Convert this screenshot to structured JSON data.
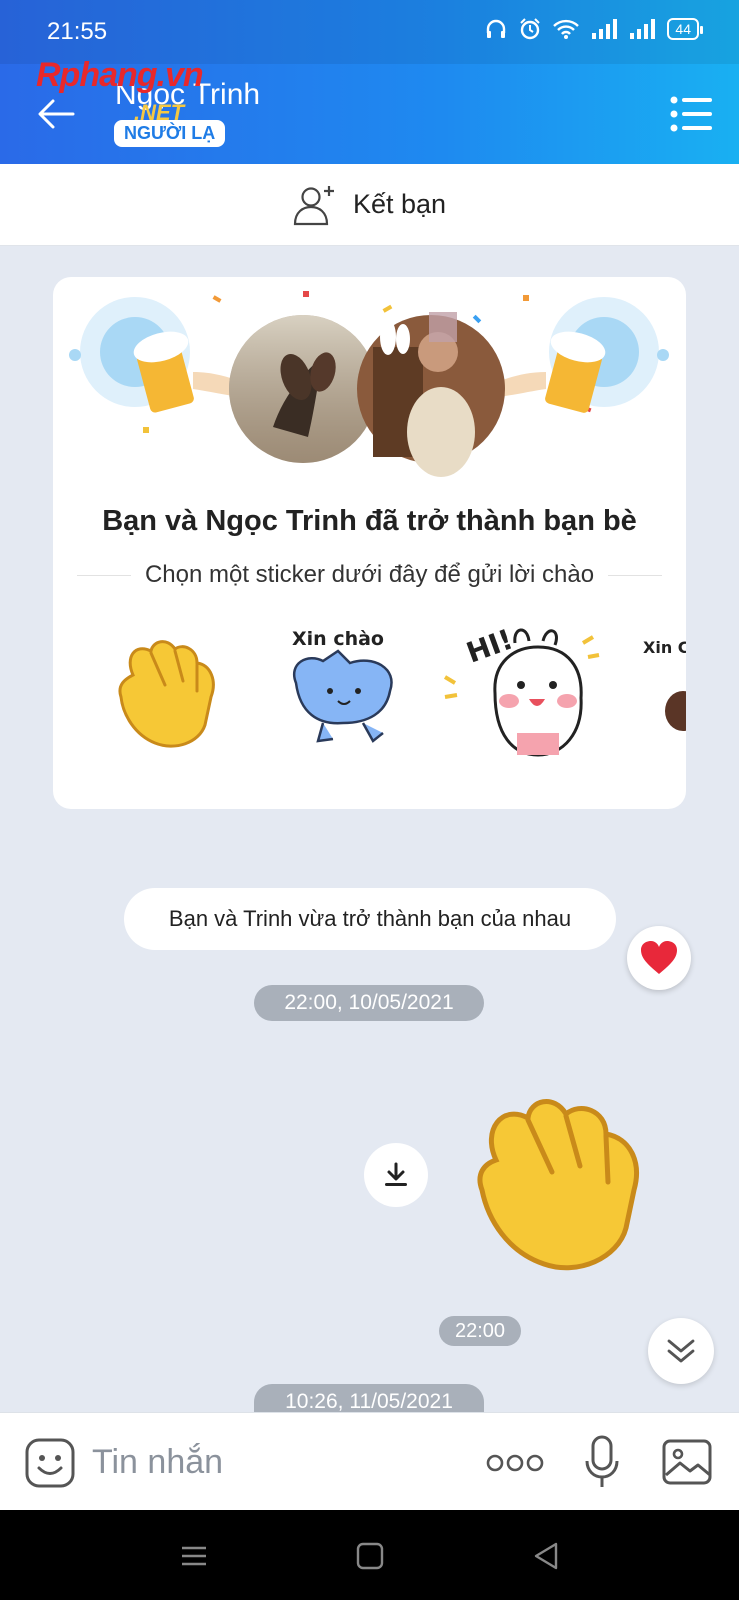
{
  "status_bar": {
    "time": "21:55",
    "battery": "44",
    "icons": [
      "headphones-icon",
      "alarm-icon",
      "wifi-icon",
      "signal-icon",
      "signal-icon",
      "battery-icon"
    ]
  },
  "watermark": {
    "brand": "Rphang.vn",
    "suffix": ".NET"
  },
  "header": {
    "title": "Ngọc Trinh",
    "badge": "NGƯỜI LẠ"
  },
  "add_friend": {
    "label": "Kết bạn"
  },
  "friend_card": {
    "title": "Bạn và Ngọc Trinh đã trở thành bạn bè",
    "subtitle": "Chọn một sticker dưới đây để gửi lời chào",
    "stickers": [
      {
        "name": "wave-hand"
      },
      {
        "name": "xin-chao-cat",
        "text": "Xin chào"
      },
      {
        "name": "hi-bunny",
        "text": "HI!"
      },
      {
        "name": "xin-chao-partial",
        "text": "Xin Chà"
      }
    ]
  },
  "messages": {
    "notice": "Bạn và Trinh vừa trở thành bạn của nhau",
    "date_1": "22:00, 10/05/2021",
    "sent_time": "22:00",
    "date_2": "10:26, 11/05/2021"
  },
  "input_bar": {
    "placeholder": "Tin nhắn"
  },
  "colors": {
    "header_start": "#2a6ae8",
    "header_end": "#19b0f2",
    "accent": "#1f7ce6",
    "background": "#e4e9f2",
    "heart": "#e8283a",
    "wave_yellow": "#f6c836"
  }
}
